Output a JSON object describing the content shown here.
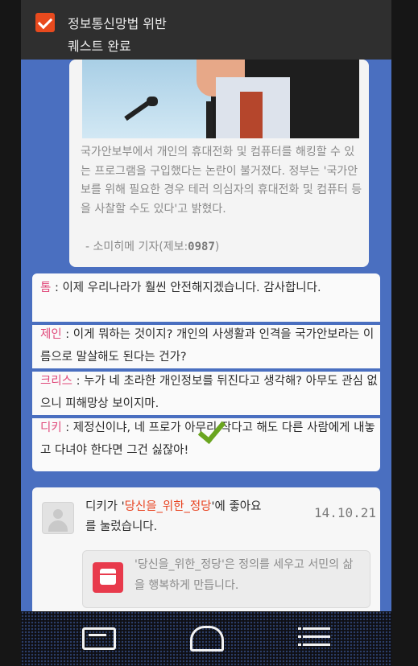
{
  "notification": {
    "title": "정보통신망법 위반",
    "subtitle": "퀘스트 완료"
  },
  "news": {
    "body": "국가안보부에서 개인의 휴대전화 및 컴퓨터를 해킹할 수 있는 프로그램을 구입했다는 논란이 불거졌다. 정부는 '국가안보를 위해 필요한 경우 테러 의심자의 휴대전화 및 컴퓨터 등을 사찰할 수도 있다'고 밝혔다.",
    "author": "- 소미히메 기자(제보:",
    "author_code": "0987",
    "author_close": ")"
  },
  "comments": [
    {
      "name": "톰",
      "text": " : 이제 우리나라가 훨씬 안전해지겠습니다. 감사합니다."
    },
    {
      "name": "제인",
      "text": " : 이게 뭐하는 것이지? 개인의 사생활과 인격을 국가안보라는 이름으로 말살해도 된다는 건가?"
    },
    {
      "name": "크리스",
      "text": " : 누가 네 초라한 개인정보를 뒤진다고 생각해? 아무도 관심 없으니 피해망상 보이지마."
    },
    {
      "name": "디키",
      "text": " : 제정신이냐, 네 프로가 아무리 작다고 해도 다른 사람에게 내놓고 다녀야 한다면 그건 싫잖아!"
    }
  ],
  "like": {
    "prefix": "디키가 '",
    "party": "당신을_위한_정당",
    "suffix": "'에 좋아요를 눌렀습니다.",
    "date": "14.10.21",
    "party_desc": "'당신을_위한_정당'은 정의를 세우고 서민의 삶을 행복하게 만듭니다."
  },
  "colors": {
    "accent": "#e84a1e",
    "name": "#e04a7b",
    "highlight": "#e8421f",
    "background": "#4a6fc0"
  },
  "icons": {
    "notification": "check-icon",
    "avatar": "user-icon",
    "party": "fist-icon",
    "nav": [
      "inbox-icon",
      "home-icon",
      "menu-icon"
    ]
  }
}
